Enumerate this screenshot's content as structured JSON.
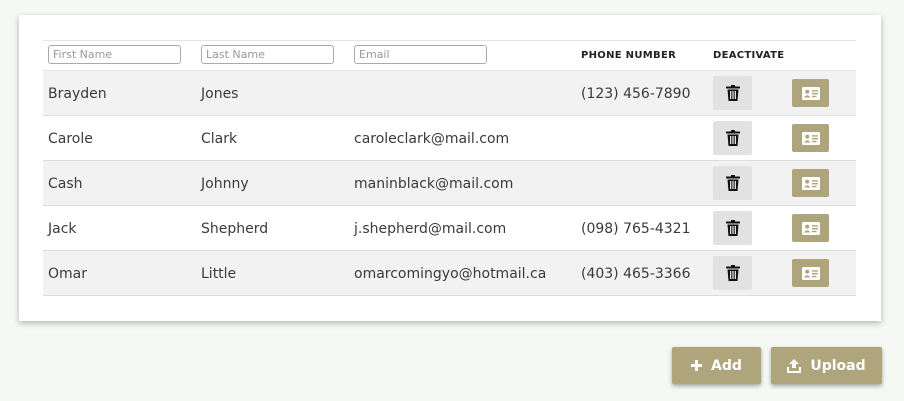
{
  "filters": {
    "first_name_placeholder": "First Name",
    "last_name_placeholder": "Last Name",
    "email_placeholder": "Email"
  },
  "headers": {
    "phone": "PHONE NUMBER",
    "deactivate": "DEACTIVATE"
  },
  "rows": [
    {
      "first": "Brayden",
      "last": "Jones",
      "email": "",
      "phone": "(123) 456-7890"
    },
    {
      "first": "Carole",
      "last": "Clark",
      "email": "caroleclark@mail.com",
      "phone": ""
    },
    {
      "first": "Cash",
      "last": "Johnny",
      "email": "maninblack@mail.com",
      "phone": ""
    },
    {
      "first": "Jack",
      "last": "Shepherd",
      "email": "j.shepherd@mail.com",
      "phone": "(098) 765-4321"
    },
    {
      "first": "Omar",
      "last": "Little",
      "email": "omarcomingyo@hotmail.ca",
      "phone": "(403) 465-3366"
    }
  ],
  "icons": {
    "deactivate": "trash-icon",
    "contact_card": "id-card-icon",
    "add": "plus-icon",
    "upload": "upload-icon"
  },
  "buttons": {
    "add_label": "Add",
    "upload_label": "Upload"
  },
  "colors": {
    "accent": "#aea57c",
    "trash_bg": "#e2e2e2",
    "row_alt": "#f2f2f2"
  }
}
